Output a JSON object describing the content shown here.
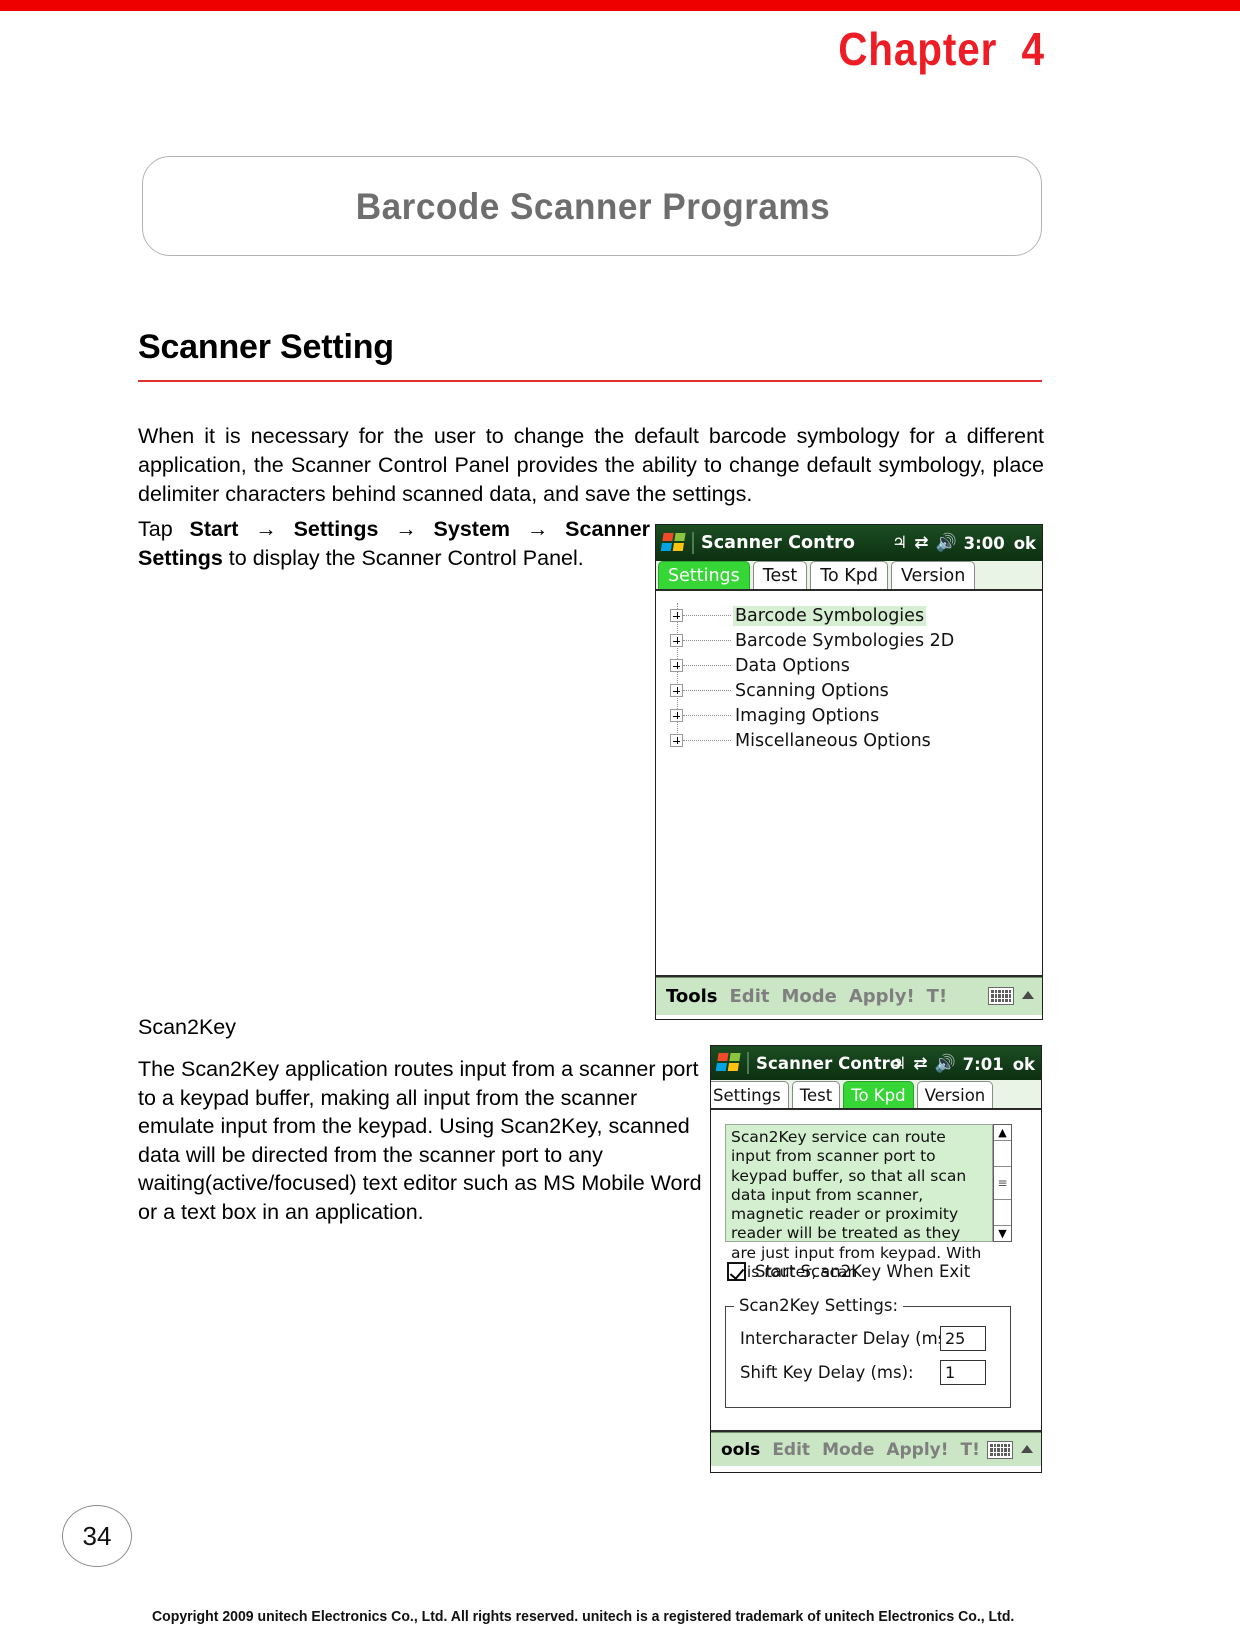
{
  "header": {
    "chapter_label": "Chapter  4",
    "box_title": "Barcode Scanner Programs"
  },
  "section": {
    "heading": "Scanner Setting",
    "intro_paragraph": "When it is necessary for the user to change the default barcode symbology for a different application, the Scanner Control Panel provides the ability to change default symbology, place delimiter characters behind scanned data, and save the settings.",
    "tap_instruction_prefix": "Tap ",
    "tap_start": "Start",
    "arrow": " → ",
    "tap_settings": "Settings",
    "tap_system": "System",
    "tap_scanner_settings": "Scanner Settings",
    "tap_instruction_suffix": " to display the Scanner Control Panel."
  },
  "scan2key_section": {
    "heading": "Scan2Key",
    "paragraph": "The Scan2Key application routes input from a scanner port to a keypad buffer, making all input from the scanner emulate input from the keypad. Using Scan2Key, scanned data will be directed from the scanner port to any waiting(active/focused) text editor such as MS Mobile Word or a text box in an application."
  },
  "screenshot1": {
    "title": "Scanner Contro",
    "clock": "3:00",
    "ok_label": "ok",
    "tray_icons": [
      "signal-icon",
      "network-icon",
      "volume-icon"
    ],
    "tabs": [
      {
        "label": "Settings",
        "active": true
      },
      {
        "label": "Test",
        "active": false
      },
      {
        "label": "To Kpd",
        "active": false
      },
      {
        "label": "Version",
        "active": false
      }
    ],
    "tree_items": [
      {
        "label": "Barcode Symbologies",
        "selected": true
      },
      {
        "label": "Barcode Symbologies 2D",
        "selected": false
      },
      {
        "label": "Data Options",
        "selected": false
      },
      {
        "label": "Scanning Options",
        "selected": false
      },
      {
        "label": "Imaging Options",
        "selected": false
      },
      {
        "label": "Miscellaneous Options",
        "selected": false
      }
    ],
    "toolbar": [
      "Tools",
      "Edit",
      "Mode",
      "Apply!",
      "T!"
    ]
  },
  "screenshot2": {
    "title": "Scanner Contro",
    "clock": "7:01",
    "ok_label": "ok",
    "tabs": [
      {
        "label": "Settings",
        "active": false
      },
      {
        "label": "Test",
        "active": false
      },
      {
        "label": "To Kpd",
        "active": true
      },
      {
        "label": "Version",
        "active": false
      }
    ],
    "description_text": "Scan2Key service can route input from scanner port to keypad buffer, so that all scan data input from scanner, magnetic reader or proximity reader will be treated as they are just input from keypad. With this router, scan",
    "checkbox_label": "Start Scan2Key When Exit",
    "checkbox_checked": true,
    "group_legend": "Scan2Key Settings:",
    "fields": [
      {
        "label": "Intercharacter Delay (ms):",
        "value": "25"
      },
      {
        "label": "Shift Key Delay (ms):",
        "value": "1"
      }
    ],
    "toolbar": [
      "ools",
      "Edit",
      "Mode",
      "Apply!",
      "T!"
    ]
  },
  "footer": {
    "page_number": "34",
    "copyright": "Copyright 2009 unitech Electronics Co., Ltd. All rights reserved. unitech is a registered trademark of unitech Electronics Co., Ltd."
  },
  "colors": {
    "accent_red": "#ee1c24",
    "rule_red": "#e03030",
    "title_gray": "#6e6e6e",
    "tab_active_green": "#35d635",
    "toolbar_green": "#cbe6c4",
    "textbox_green": "#d4efd0"
  }
}
